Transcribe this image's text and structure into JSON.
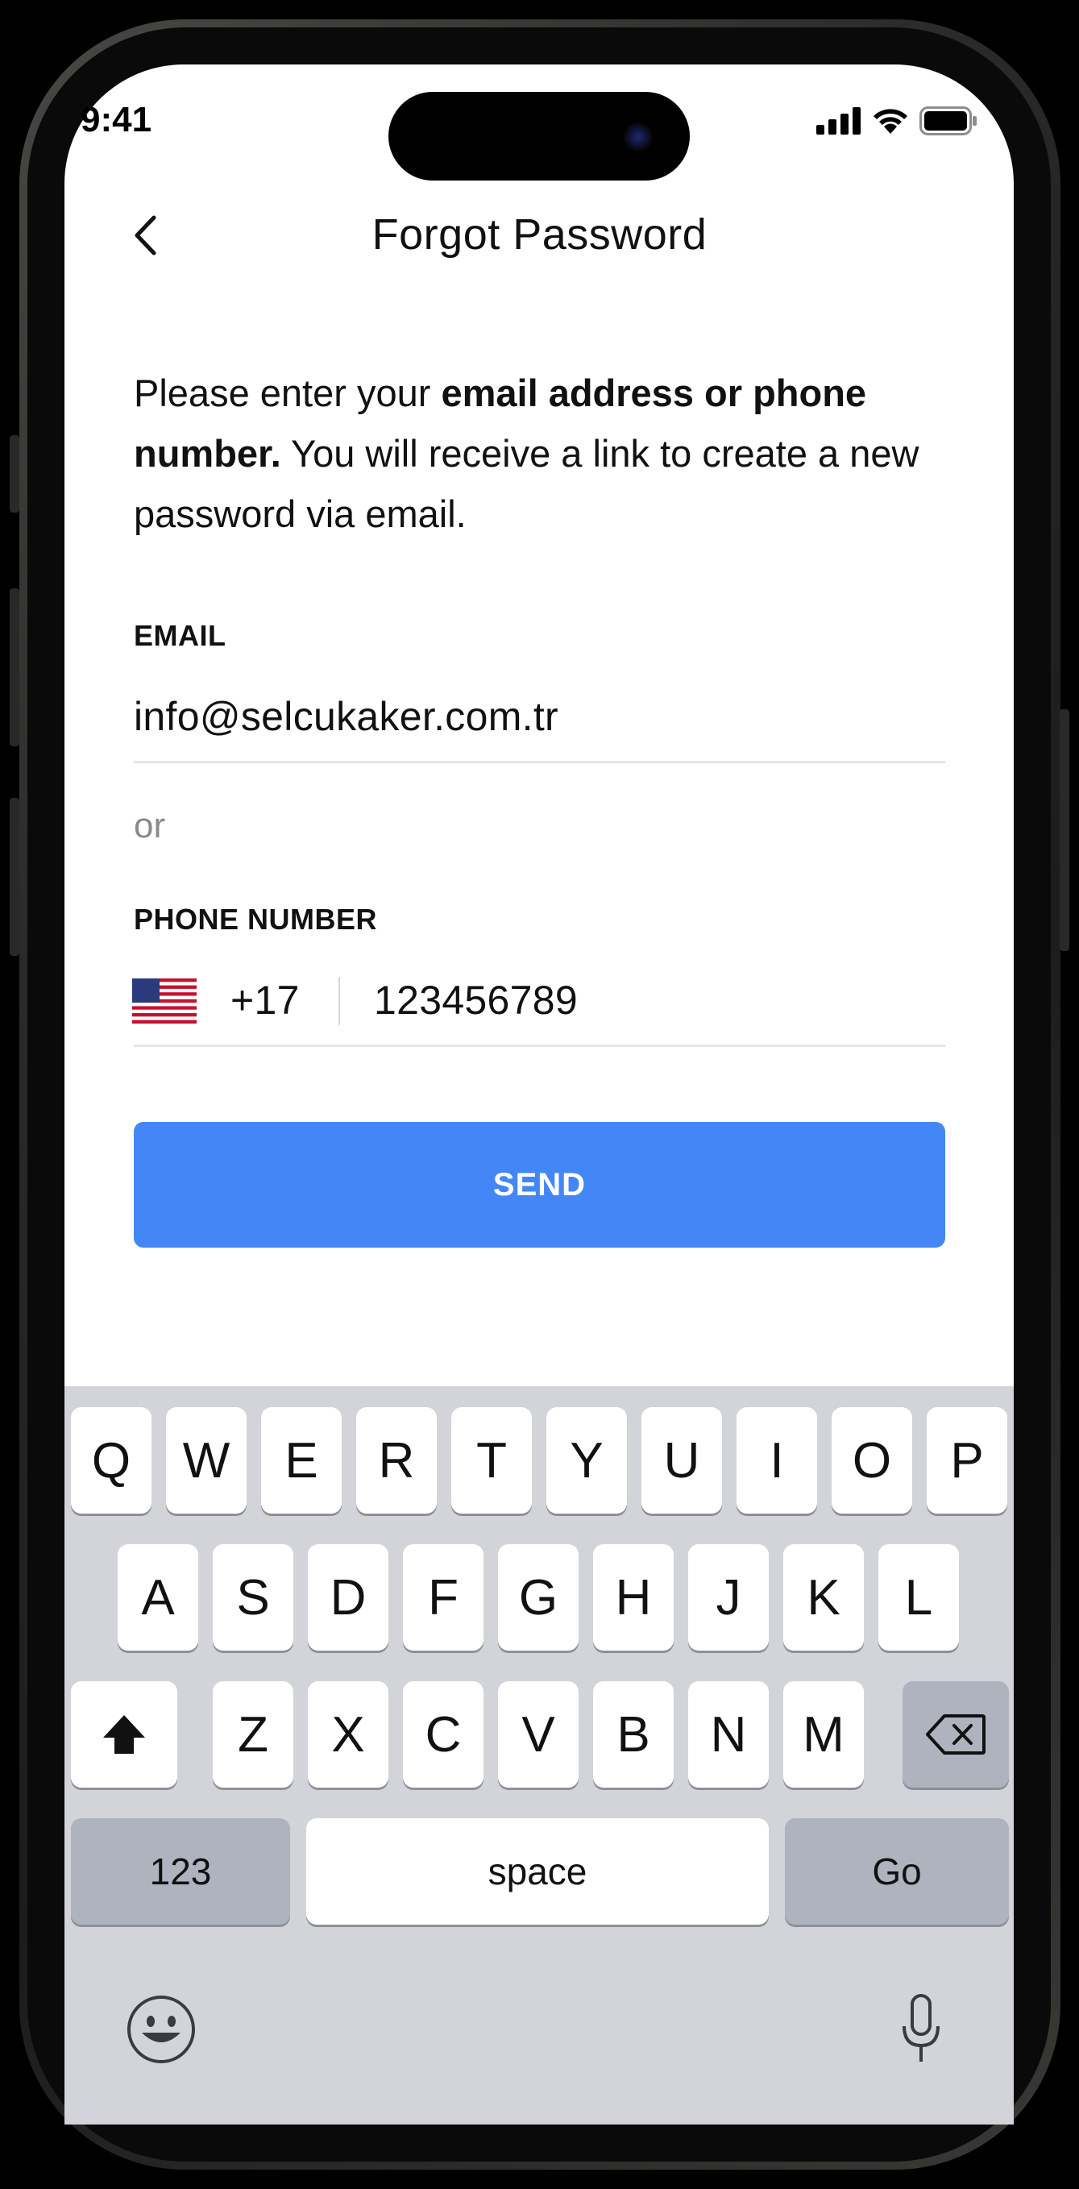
{
  "status_bar": {
    "time": "9:41"
  },
  "header": {
    "title": "Forgot Password"
  },
  "description": {
    "part1": "Please enter your ",
    "bold": "email address or phone number.",
    "part2": " You will receive a link to create a new password via email."
  },
  "email": {
    "label": "EMAIL",
    "value": "info@selcukaker.com.tr"
  },
  "or_text": "or",
  "phone": {
    "label": "PHONE NUMBER",
    "country_code": "+17",
    "number": "123456789",
    "flag": "us-flag-icon"
  },
  "send_button": {
    "label": "SEND",
    "color": "#4287f5"
  },
  "keyboard": {
    "row1": [
      "Q",
      "W",
      "E",
      "R",
      "T",
      "Y",
      "U",
      "I",
      "O",
      "P"
    ],
    "row2": [
      "A",
      "S",
      "D",
      "F",
      "G",
      "H",
      "J",
      "K",
      "L"
    ],
    "row3": [
      "Z",
      "X",
      "C",
      "V",
      "B",
      "N",
      "M"
    ],
    "numbers_key": "123",
    "space_key": "space",
    "go_key": "Go"
  }
}
